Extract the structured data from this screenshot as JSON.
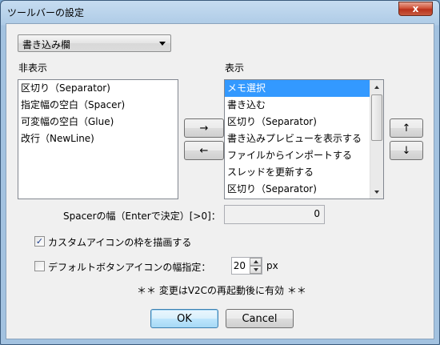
{
  "window": {
    "title": "ツールバーの設定",
    "close_glyph": "x"
  },
  "toolbar_select": {
    "selected": "書き込み欄"
  },
  "hidden": {
    "label": "非表示",
    "items": [
      "区切り（Separator)",
      "指定幅の空白（Spacer)",
      "可変幅の空白（Glue)",
      "改行（NewLine)"
    ]
  },
  "visible": {
    "label": "表示",
    "items": [
      "メモ選択",
      "書き込む",
      "区切り（Separator)",
      "書き込みプレビューを表示する",
      "ファイルからインポートする",
      "スレッドを更新する",
      "区切り（Separator)"
    ],
    "selected_index": 0
  },
  "transfer": {
    "right": "→",
    "left": "←"
  },
  "order": {
    "up": "↑",
    "down": "↓"
  },
  "spacer": {
    "label": "Spacerの幅（Enterで決定）[>0]：",
    "value": "0"
  },
  "custom_icon_frame": {
    "label": "カスタムアイコンの枠を描画する",
    "checked": true,
    "mark": "✓"
  },
  "default_icon_width": {
    "label": "デフォルトボタンアイコンの幅指定：",
    "checked": false,
    "value": "20",
    "unit": "px"
  },
  "notice": "＊＊ 変更はV2Cの再起動後に有効 ＊＊",
  "buttons": {
    "ok": "OK",
    "cancel": "Cancel"
  }
}
